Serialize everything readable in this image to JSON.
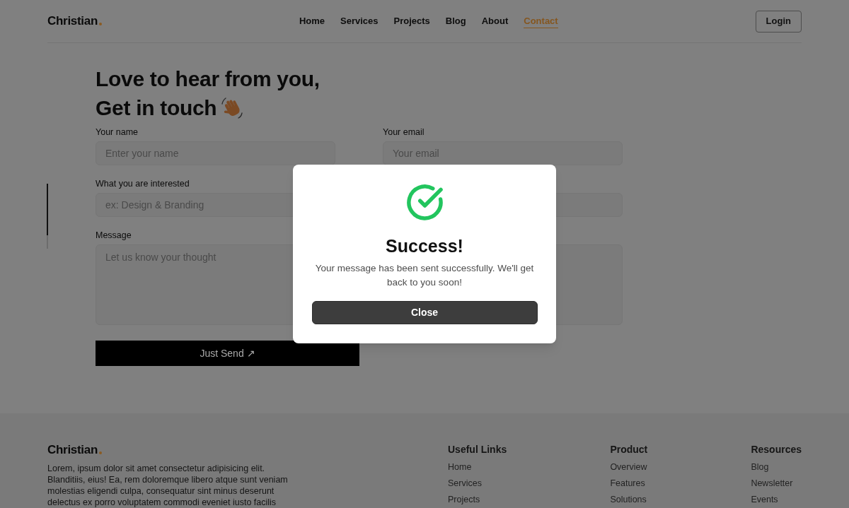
{
  "header": {
    "logo": "Christian",
    "nav": [
      {
        "label": "Home",
        "selected": false
      },
      {
        "label": "Services",
        "selected": false
      },
      {
        "label": "Projects",
        "selected": false
      },
      {
        "label": "Blog",
        "selected": false
      },
      {
        "label": "About",
        "selected": false
      },
      {
        "label": "Contact",
        "selected": true
      }
    ],
    "login_button": "Login"
  },
  "heading": {
    "lines": [
      "Love to hear from you,",
      "Get in touch"
    ]
  },
  "form": {
    "rows": [
      {
        "fields": [
          {
            "kind": "input",
            "label": "Your name",
            "placeholder": "Enter your name"
          },
          {
            "kind": "input",
            "label": "Your email",
            "placeholder": "Your email"
          }
        ]
      },
      {
        "fields": [
          {
            "kind": "input",
            "label": "What you are interested",
            "placeholder": "ex: Design & Branding"
          }
        ]
      },
      {
        "fields": [
          {
            "kind": "textarea",
            "label": "Message",
            "placeholder": "Let us know your thought"
          }
        ]
      }
    ],
    "submit_button": "Just Send ↗"
  },
  "dialog": {
    "title": "Success!",
    "message": "Your message has been sent successfully. We'll get back to you soon!",
    "button": "Close"
  },
  "footer": {
    "logo": "Christian",
    "about": "Lorem, ipsum dolor sit amet consectetur adipisicing elit. Blanditiis, eius! Ea, rem doloremque libero atque sunt veniam molestias eligendi culpa, consequatur sint minus deserunt delectus ex porro voluptatem commodi eveniet iusto facilis",
    "columns": [
      {
        "title": "Useful Links",
        "links": [
          "Home",
          "Services",
          "Projects"
        ]
      },
      {
        "title": "Product",
        "links": [
          "Overview",
          "Features",
          "Solutions"
        ]
      },
      {
        "title": "Resources",
        "links": [
          "Blog",
          "Newsletter",
          "Events"
        ]
      }
    ]
  }
}
